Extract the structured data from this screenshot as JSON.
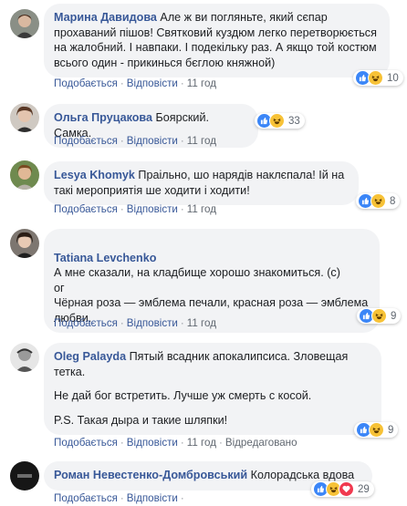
{
  "actions": {
    "like": "Подобається",
    "reply": "Відповісти",
    "separator": "·",
    "edited": "Відредаговано"
  },
  "comments": [
    {
      "author": "Марина Давидова",
      "lines": [
        "Але ж ви погляньте, який сєпар прохаваний пішов! Святковий куздюм легко перетворюється на жалобний. І навпаки. І подекільку раз. А якщо той костюм всього один - прикинься бєглою княжной)"
      ],
      "time": "11 год",
      "reactions": [
        "like",
        "haha"
      ],
      "count": "10"
    },
    {
      "author": "Ольга Пруцакова",
      "lines": [
        "Боярский. Самка."
      ],
      "time": "11 год",
      "reactions": [
        "like",
        "haha"
      ],
      "count": "33"
    },
    {
      "author": "Lesya Khomyk",
      "lines": [
        "Праільно, шо нарядів наклєпала! Ій на такі мероприятія ше ходити і ходити!"
      ],
      "time": "11 год",
      "reactions": [
        "like",
        "haha"
      ],
      "count": "8"
    },
    {
      "author": "Tatiana Levchenko",
      "lines": [
        "А мне сказали, на кладбище хорошо знакомиться. (с)\nог\nЧёрная роза — эмблема печали, красная роза — эмблема любви."
      ],
      "time": "11 год",
      "reactions": [
        "like",
        "haha"
      ],
      "count": "9"
    },
    {
      "author": "Oleg Palayda",
      "lines": [
        "Пятый всадник апокалипсиса. Зловещая тетка.",
        "Не дай бог встретить. Лучше уж смерть с косой.",
        "P.S. Такая дыра и такие шляпки!"
      ],
      "time": "11 год",
      "edited": true,
      "reactions": [
        "like",
        "haha"
      ],
      "count": "9"
    },
    {
      "author": "Роман Невестенко-Домбровський",
      "lines": [
        "Колорадська вдова"
      ],
      "time": "",
      "reactions": [
        "like",
        "haha",
        "love"
      ],
      "count": "29"
    }
  ]
}
